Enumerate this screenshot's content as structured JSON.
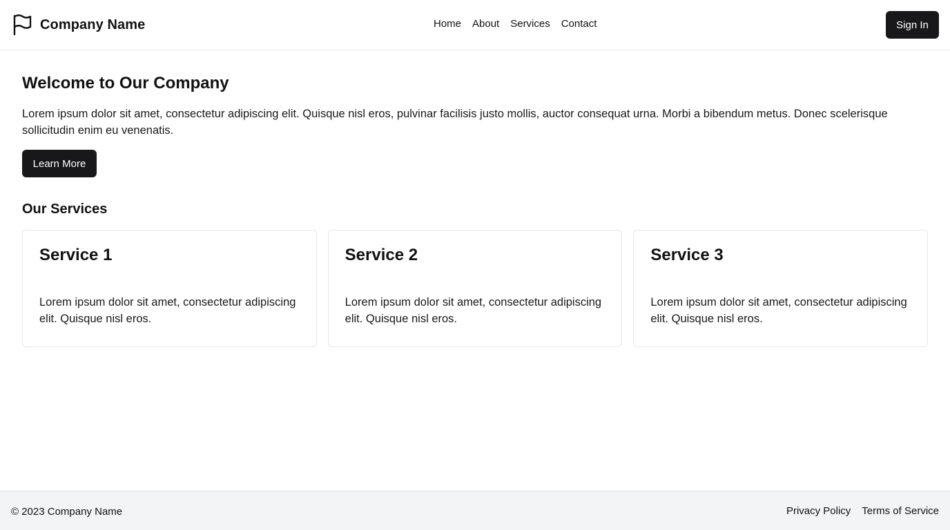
{
  "header": {
    "brand_name": "Company Name",
    "brand_icon": "flag-icon",
    "nav": [
      "Home",
      "About",
      "Services",
      "Contact"
    ],
    "sign_in_label": "Sign In"
  },
  "hero": {
    "title": "Welcome to Our Company",
    "text": "Lorem ipsum dolor sit amet, consectetur adipiscing elit. Quisque nisl eros, pulvinar facilisis justo mollis, auctor consequat urna. Morbi a bibendum metus. Donec scelerisque sollicitudin enim eu venenatis.",
    "button_label": "Learn More"
  },
  "services": {
    "title": "Our Services",
    "cards": [
      {
        "title": "Service 1",
        "text": "Lorem ipsum dolor sit amet, consectetur adipiscing elit. Quisque nisl eros."
      },
      {
        "title": "Service 2",
        "text": "Lorem ipsum dolor sit amet, consectetur adipiscing elit. Quisque nisl eros."
      },
      {
        "title": "Service 3",
        "text": "Lorem ipsum dolor sit amet, consectetur adipiscing elit. Quisque nisl eros."
      }
    ]
  },
  "footer": {
    "copyright": "© 2023 Company Name",
    "links": [
      "Privacy Policy",
      "Terms of Service"
    ]
  },
  "colors": {
    "dark_button": "#18181b",
    "border": "#e5e7eb",
    "footer_bg": "#f3f4f6"
  }
}
